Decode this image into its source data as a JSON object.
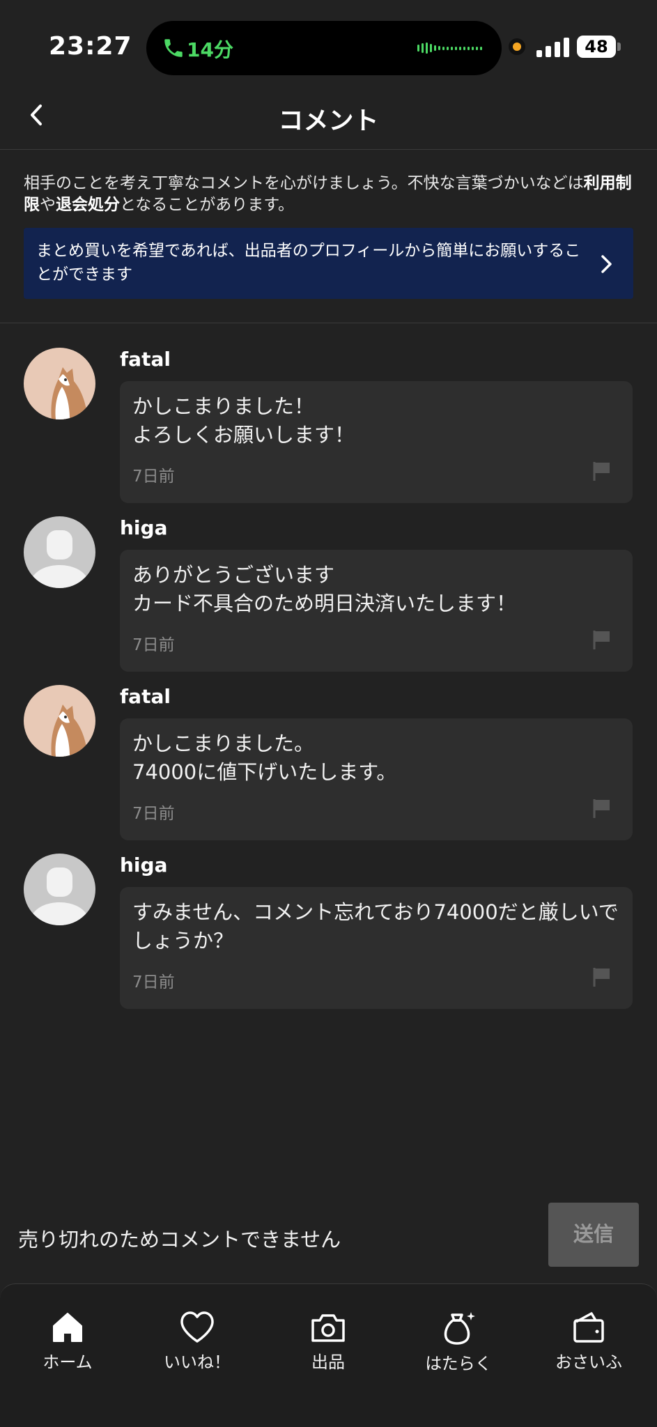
{
  "status_bar": {
    "time": "23:27",
    "call_duration": "14分",
    "battery": "48"
  },
  "header": {
    "title": "コメント"
  },
  "notice": {
    "text_before": "相手のことを考え丁寧なコメントを心がけましょう。不快な言葉づかいなどは",
    "bold_1": "利用制限",
    "text_middle": "や",
    "bold_2": "退会処分",
    "text_after": "となることがあります。"
  },
  "banner": {
    "text": "まとめ買いを希望であれば、出品者のプロフィールから簡単にお願いすることができます"
  },
  "comments": [
    {
      "user": "fatal",
      "text": "かしこまりました！\nよろしくお願いします！",
      "time": "7日前",
      "avatar": "cat"
    },
    {
      "user": "higa",
      "text": "ありがとうございます\nカード不具合のため明日決済いたします！",
      "time": "7日前",
      "avatar": "default"
    },
    {
      "user": "fatal",
      "text": "かしこまりました。\n74000に値下げいたします。",
      "time": "7日前",
      "avatar": "cat"
    },
    {
      "user": "higa",
      "text": "すみません、コメント忘れており74000だと厳しいでしょうか？",
      "time": "7日前",
      "avatar": "default"
    }
  ],
  "input": {
    "sold_out_message": "売り切れのためコメントできません",
    "send_label": "送信"
  },
  "tabs": [
    {
      "label": "ホーム",
      "icon": "home-icon"
    },
    {
      "label": "いいね！",
      "icon": "heart-icon"
    },
    {
      "label": "出品",
      "icon": "camera-icon"
    },
    {
      "label": "はたらく",
      "icon": "money-bag-icon"
    },
    {
      "label": "おさいふ",
      "icon": "wallet-icon"
    }
  ],
  "colors": {
    "background": "#222222",
    "bubble": "#2e2e2e",
    "banner": "#12234f",
    "call_green": "#4cd964"
  }
}
